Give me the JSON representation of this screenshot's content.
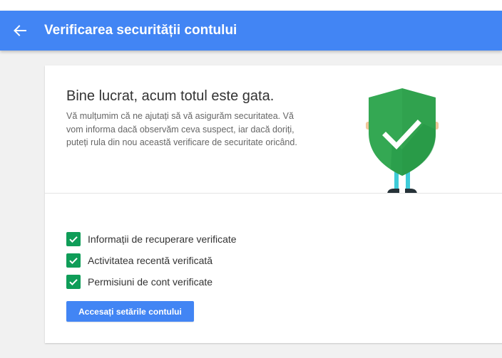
{
  "header": {
    "title": "Verificarea securității contului",
    "back_icon": "arrow-back-icon",
    "background_color": "#4285f4"
  },
  "result": {
    "headline": "Bine lucrat, acum totul este gata.",
    "message": "Vă mulțumim că ne ajutați să vă asigurăm securitatea. Vă vom informa dacă observăm ceva suspect, iar dacă doriți, puteți rula din nou această verificare de securitate oricând.",
    "illustration": "shield-check-icon",
    "shield_color": "#34a853"
  },
  "checklist": [
    {
      "label": "Informații de recuperare verificate",
      "icon": "checkbox-checked-icon"
    },
    {
      "label": "Activitatea recentă verificată",
      "icon": "checkbox-checked-icon"
    },
    {
      "label": "Permisiuni de cont verificate",
      "icon": "checkbox-checked-icon"
    }
  ],
  "actions": {
    "primary_label": "Accesați setările contului"
  },
  "colors": {
    "accent": "#4285f4",
    "check": "#0f9d58"
  }
}
